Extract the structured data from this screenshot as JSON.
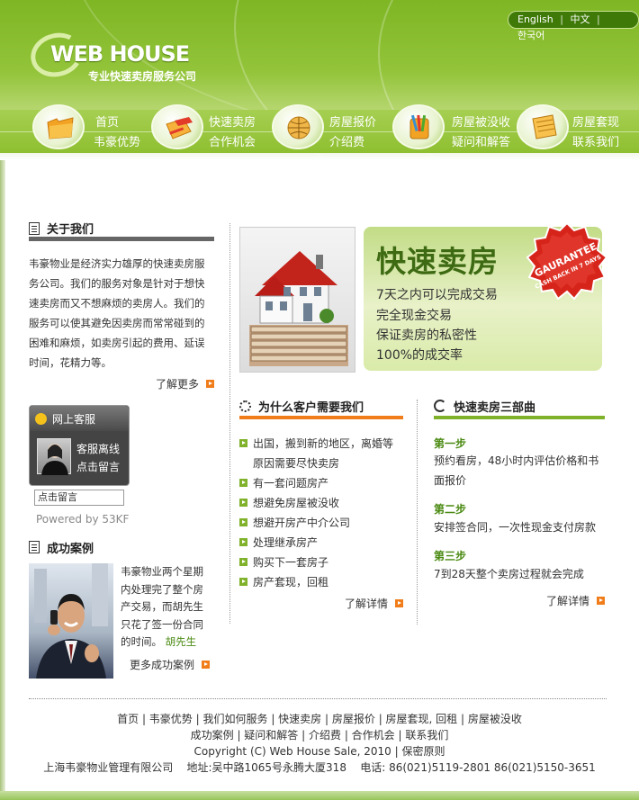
{
  "lang": {
    "english": "English",
    "sep1": "|",
    "chinese": "中文",
    "sep2": "|",
    "korean": "한국어"
  },
  "logo": {
    "title": "WEB HOUSE",
    "subtitle": "专业快速卖房服务公司"
  },
  "nav": {
    "items": [
      {
        "top": "首页",
        "bottom": "韦豪优势",
        "icon": "folder-icon"
      },
      {
        "top": "快速卖房",
        "bottom": "合作机会",
        "icon": "pen-paper-icon"
      },
      {
        "top": "房屋报价",
        "bottom": "介绍费",
        "icon": "globe-icon"
      },
      {
        "top": "房屋被没收",
        "bottom": "疑问和解答",
        "icon": "pencils-icon"
      },
      {
        "top": "房屋套现",
        "bottom": "联系我们",
        "icon": "notebook-icon"
      }
    ]
  },
  "about": {
    "title": "关于我们",
    "lines": [
      "韦豪物业是经济实力雄厚的快速卖房服",
      "务公司。我们的服务对象是针对于想快",
      "速卖房而又不想麻烦的卖房人。我们的",
      "服务可以使其避免因卖房而常常碰到的",
      "困难和麻烦，如卖房引起的费用、延误",
      "时间，花精力等。"
    ],
    "more": "了解更多"
  },
  "support": {
    "title": "网上客服",
    "offline": "客服离线",
    "leave_msg": "点击留言",
    "input_value": "点击留言",
    "powered": "Powered by 53KF"
  },
  "cases": {
    "title": "成功案例",
    "lines": [
      "韦豪物业两个星期",
      "内处理完了整个房",
      "产交易，而胡先生",
      "只花了签一份合同",
      "的时间。"
    ],
    "person": "胡先生",
    "more": "更多成功案例"
  },
  "banner": {
    "title": "快速卖房",
    "points": [
      "7天之内可以完成交易",
      "完全现金交易",
      "保证卖房的私密性",
      "100%的成交率"
    ],
    "badge_line1": "GAURANTEE",
    "badge_line2": "CASH BACK IN 7 DAYS"
  },
  "why": {
    "title": "为什么客户需要我们",
    "items": [
      "出国，搬到新的地区，离婚等",
      "原因需要尽快卖房",
      "有一套问题房产",
      "想避免房屋被没收",
      "想避开房产中介公司",
      "处理继承房产",
      "购买下一套房子",
      "房产套现，回租"
    ],
    "more": "了解详情"
  },
  "steps": {
    "title": "快速卖房三部曲",
    "s1": "第一步",
    "t1a": "预约看房，48小时内评估价格和书",
    "t1b": "面报价",
    "s2": "第二步",
    "t2": "安排签合同，一次性现金支付房款",
    "s3": "第三步",
    "t3": "7到28天整个卖房过程就会完成",
    "more": "了解详情"
  },
  "footer": {
    "row1": [
      "首页",
      "韦豪优势",
      "我们如何服务",
      "快速卖房",
      "房屋报价",
      "房屋套现, 回租",
      "房屋被没收"
    ],
    "row2": [
      "成功案例",
      "疑问和解答",
      "介绍费",
      "合作机会",
      "联系我们"
    ],
    "copyright": "Copyright (C) Web House Sale, 2010",
    "privacy": "保密原则",
    "company": "上海韦豪物业管理有限公司",
    "address": "地址:吴中路1065号永腾大厦318",
    "phone": "电话: 86(021)5119-2801 86(021)5150-3651",
    "sep": "|"
  },
  "colors": {
    "brand_green": "#8ebf30",
    "accent_orange": "#f07d1a",
    "dark_green": "#3d6a12"
  }
}
